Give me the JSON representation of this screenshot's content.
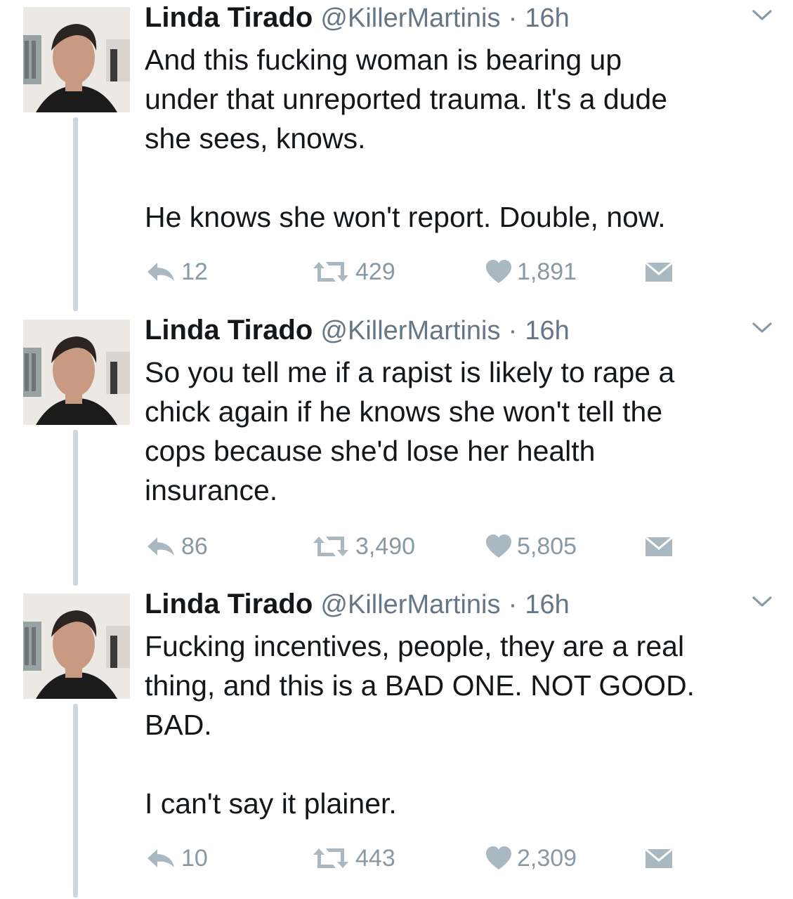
{
  "tweets": [
    {
      "name": "Linda Tirado",
      "handle": "@KillerMartinis",
      "separator": "·",
      "time": "16h",
      "lines": [
        "And this fucking woman is bearing up",
        "under that unreported trauma. It's a dude",
        "she sees, knows.",
        "He knows she won't report. Double, now."
      ],
      "replies": "12",
      "retweets": "429",
      "likes": "1,891"
    },
    {
      "name": "Linda Tirado",
      "handle": "@KillerMartinis",
      "separator": "·",
      "time": "16h",
      "lines": [
        "So you tell me if a rapist is likely to rape a",
        "chick again if he knows she won't tell the",
        "cops because she'd lose her health",
        "insurance."
      ],
      "replies": "86",
      "retweets": "3,490",
      "likes": "5,805"
    },
    {
      "name": "Linda Tirado",
      "handle": "@KillerMartinis",
      "separator": "·",
      "time": "16h",
      "lines": [
        "Fucking incentives, people, they are a real",
        "thing, and this is a BAD ONE. NOT GOOD.",
        "BAD.",
        "I can't say it plainer."
      ],
      "replies": "10",
      "retweets": "443",
      "likes": "2,309"
    }
  ],
  "icons": {
    "avatar": "profile-photo",
    "more": "chevron-down-icon",
    "reply": "reply-icon",
    "retweet": "retweet-icon",
    "like": "heart-icon",
    "dm": "envelope-icon"
  },
  "colors": {
    "text": "#14171a",
    "secondary": "#657786",
    "action": "#8899a6",
    "thread_line": "#ccd6dd",
    "background": "#ffffff"
  }
}
